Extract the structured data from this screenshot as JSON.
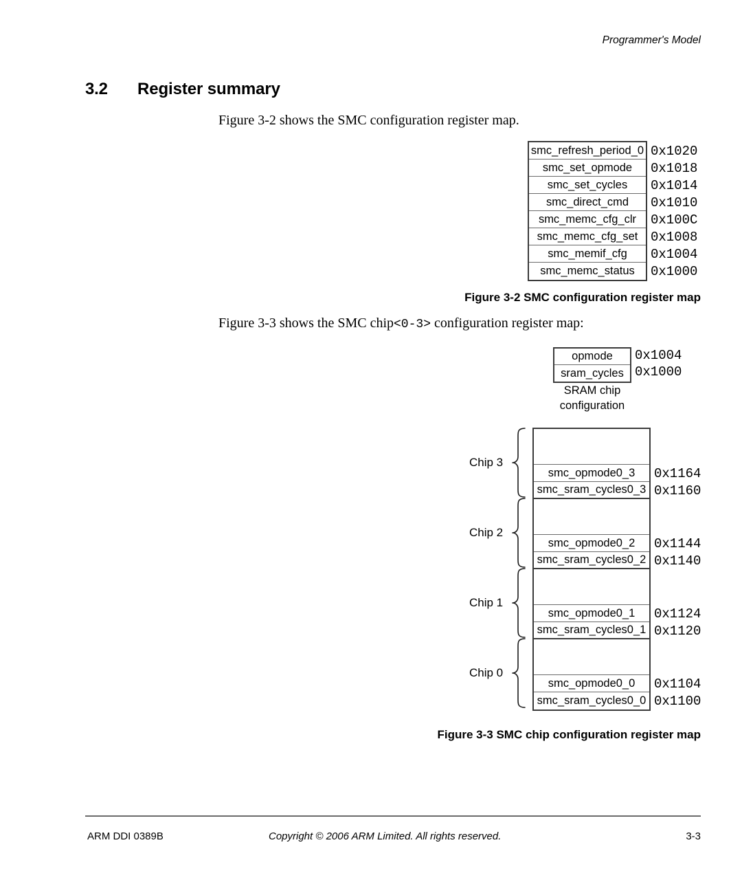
{
  "header": {
    "running_head": "Programmer's Model"
  },
  "section": {
    "number": "3.2",
    "title": "Register summary"
  },
  "paragraphs": {
    "intro_fig2": "Figure 3-2 shows the SMC configuration register map.",
    "intro_fig3_before": "Figure 3-3 shows the SMC chip",
    "intro_fig3_code": "<0-3>",
    "intro_fig3_after": " configuration register map:"
  },
  "figure_2": {
    "caption": "Figure 3-2 SMC configuration register map",
    "rows": [
      {
        "name": "smc_refresh_period_0",
        "address": "0x1020"
      },
      {
        "name": "smc_set_opmode",
        "address": "0x1018"
      },
      {
        "name": "smc_set_cycles",
        "address": "0x1014"
      },
      {
        "name": "smc_direct_cmd",
        "address": "0x1010"
      },
      {
        "name": "smc_memc_cfg_clr",
        "address": "0x100C"
      },
      {
        "name": "smc_memc_cfg_set",
        "address": "0x1008"
      },
      {
        "name": "smc_memif_cfg",
        "address": "0x1004"
      },
      {
        "name": "smc_memc_status",
        "address": "0x1000"
      }
    ]
  },
  "figure_3": {
    "caption": "Figure 3-3 SMC chip configuration register map",
    "sram": {
      "caption_line1": "SRAM chip",
      "caption_line2": "configuration",
      "rows": [
        {
          "name": "opmode",
          "address": "0x1004"
        },
        {
          "name": "sram_cycles",
          "address": "0x1000"
        }
      ]
    },
    "chips": [
      {
        "label": "Chip 3",
        "rows": [
          {
            "name": "smc_opmode0_3",
            "address": "0x1164"
          },
          {
            "name": "smc_sram_cycles0_3",
            "address": "0x1160"
          }
        ]
      },
      {
        "label": "Chip 2",
        "rows": [
          {
            "name": "smc_opmode0_2",
            "address": "0x1144"
          },
          {
            "name": "smc_sram_cycles0_2",
            "address": "0x1140"
          }
        ]
      },
      {
        "label": "Chip 1",
        "rows": [
          {
            "name": "smc_opmode0_1",
            "address": "0x1124"
          },
          {
            "name": "smc_sram_cycles0_1",
            "address": "0x1120"
          }
        ]
      },
      {
        "label": "Chip 0",
        "rows": [
          {
            "name": "smc_opmode0_0",
            "address": "0x1104"
          },
          {
            "name": "smc_sram_cycles0_0",
            "address": "0x1100"
          }
        ]
      }
    ]
  },
  "footer": {
    "doc_id": "ARM DDI 0389B",
    "copyright": "Copyright © 2006 ARM Limited. All rights reserved.",
    "page_number": "3-3"
  }
}
